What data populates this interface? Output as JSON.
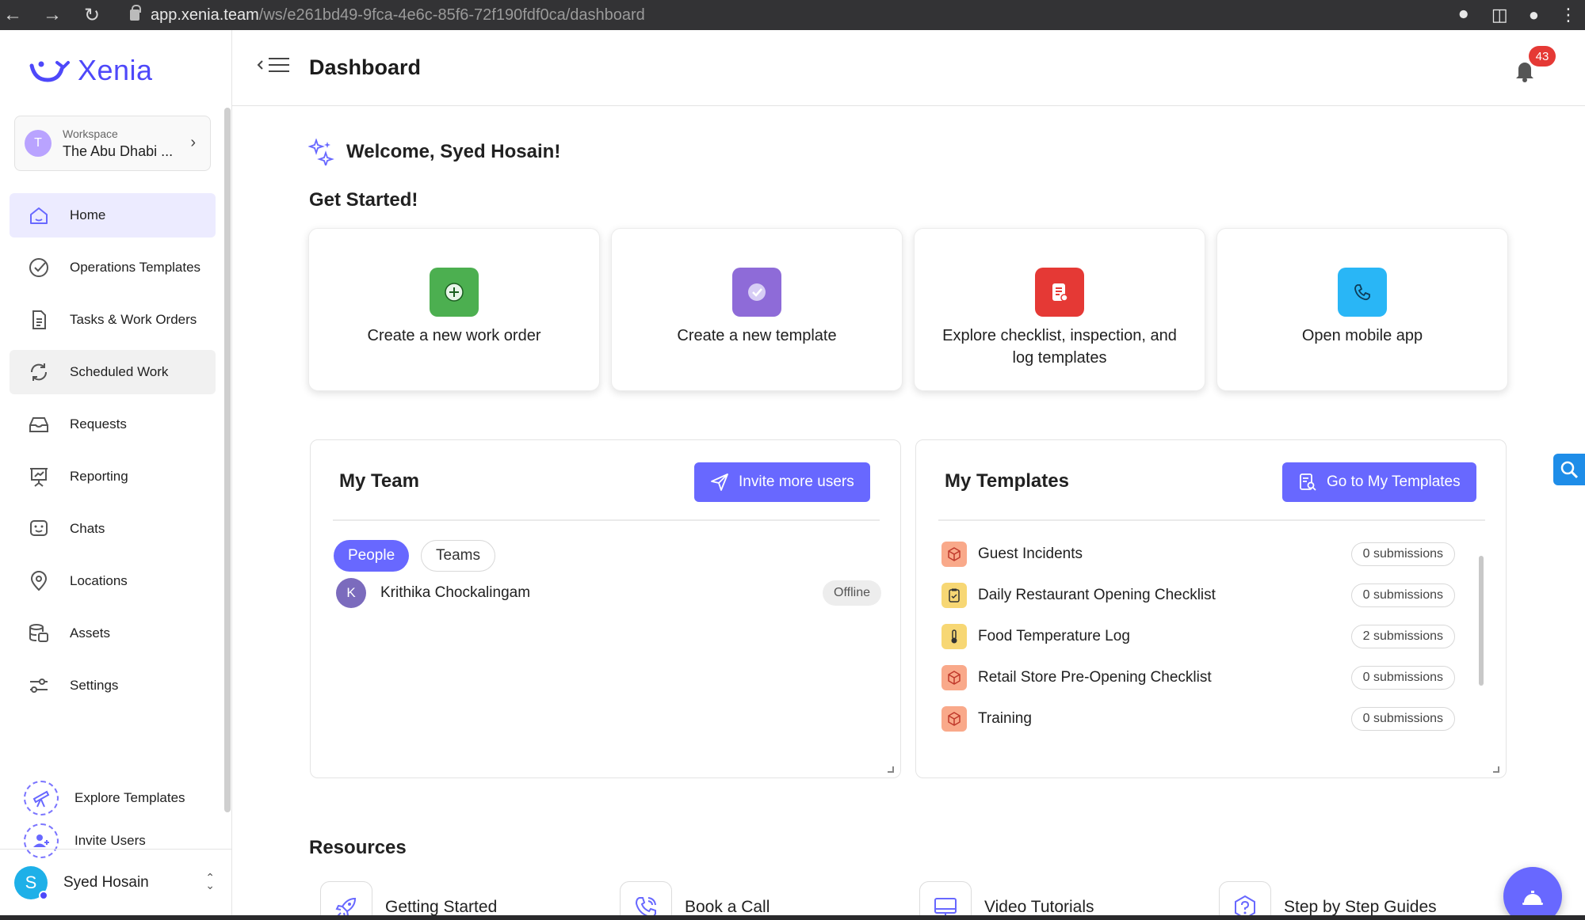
{
  "browser": {
    "url_host": "app.xenia.team",
    "url_path": "/ws/e261bd49-9fca-4e6c-85f6-72f190fdf0ca/dashboard"
  },
  "brand": {
    "name": "Xenia",
    "color": "#4e48fa"
  },
  "workspace": {
    "label": "Workspace",
    "name": "The Abu Dhabi ...",
    "initial": "T"
  },
  "sidebar": {
    "items": [
      {
        "label": "Home",
        "icon": "home-icon"
      },
      {
        "label": "Operations Templates",
        "icon": "check-circle-icon"
      },
      {
        "label": "Tasks & Work Orders",
        "icon": "document-icon"
      },
      {
        "label": "Scheduled Work",
        "icon": "refresh-icon"
      },
      {
        "label": "Requests",
        "icon": "inbox-icon"
      },
      {
        "label": "Reporting",
        "icon": "presentation-chart-icon"
      },
      {
        "label": "Chats",
        "icon": "chat-icon"
      },
      {
        "label": "Locations",
        "icon": "location-pin-icon"
      },
      {
        "label": "Assets",
        "icon": "database-icon"
      },
      {
        "label": "Settings",
        "icon": "sliders-icon"
      }
    ],
    "extras": [
      {
        "label": "Explore Templates",
        "icon": "telescope-icon"
      },
      {
        "label": "Invite Users",
        "icon": "add-user-icon"
      }
    ],
    "user": {
      "name": "Syed Hosain",
      "initial": "S"
    }
  },
  "header": {
    "title": "Dashboard",
    "notification_count": "43"
  },
  "welcome": {
    "text": "Welcome, Syed Hosain!",
    "get_started": "Get Started!"
  },
  "get_started_cards": [
    {
      "label": "Create a new work order",
      "color": "#4caf50"
    },
    {
      "label": "Create a new template",
      "color": "#8e6bd8"
    },
    {
      "label": "Explore checklist, inspection, and log templates",
      "color": "#e53935"
    },
    {
      "label": "Open mobile app",
      "color": "#29b6f6"
    }
  ],
  "my_team": {
    "title": "My Team",
    "button": "Invite more users",
    "tabs": [
      "People",
      "Teams"
    ],
    "members": [
      {
        "name": "Krithika Chockalingam",
        "initial": "K",
        "status": "Offline"
      }
    ]
  },
  "my_templates": {
    "title": "My Templates",
    "button": "Go to My Templates",
    "items": [
      {
        "name": "Guest Incidents",
        "submissions": "0 submissions",
        "icon": "package-icon"
      },
      {
        "name": "Daily Restaurant Opening Checklist",
        "submissions": "0 submissions",
        "icon": "clipboard-icon"
      },
      {
        "name": "Food Temperature Log",
        "submissions": "2 submissions",
        "icon": "thermometer-icon"
      },
      {
        "name": "Retail Store Pre-Opening Checklist",
        "submissions": "0 submissions",
        "icon": "package-icon"
      },
      {
        "name": "Training",
        "submissions": "0 submissions",
        "icon": "package-icon"
      }
    ]
  },
  "resources": {
    "title": "Resources",
    "items": [
      {
        "label": "Getting Started",
        "icon": "rocket-icon"
      },
      {
        "label": "Book a Call",
        "icon": "phone-icon"
      },
      {
        "label": "Video Tutorials",
        "icon": "monitor-icon"
      },
      {
        "label": "Step by Step Guides",
        "icon": "help-icon"
      }
    ]
  }
}
